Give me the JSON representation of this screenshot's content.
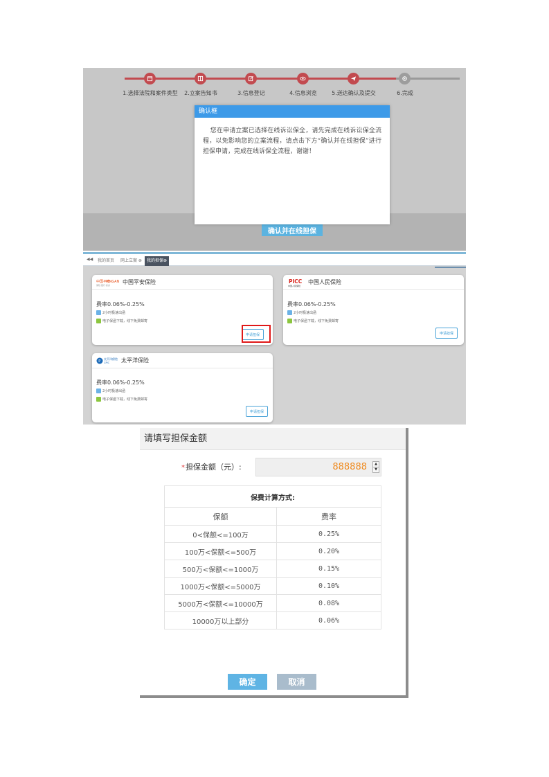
{
  "steps": [
    {
      "label": "1.选择法院和案件类型",
      "icon": "calendar-icon",
      "done": true
    },
    {
      "label": "2.立案告知书",
      "icon": "book-icon",
      "done": true
    },
    {
      "label": "3.信息登记",
      "icon": "edit-icon",
      "done": true
    },
    {
      "label": "4.信息浏览",
      "icon": "eye-icon",
      "done": true
    },
    {
      "label": "5.送达确认及提交",
      "icon": "send-icon",
      "done": true
    },
    {
      "label": "6.完成",
      "icon": "gear-icon",
      "done": false
    }
  ],
  "modal": {
    "title": "确认框",
    "body": "您在申请立案已选择在线诉讼保全，请先完成在线诉讼保全流程，以免影响您的立案流程，请点击下方“确认并在线担保”进行担保申请，完成在线诉保全流程，谢谢！"
  },
  "confirm_button": "确认并在线担保",
  "tabs": {
    "items": [
      "我的首页",
      "网上立案 ⊗",
      "我的担保⊗"
    ],
    "active_index": 2
  },
  "insurers": [
    {
      "name": "中国平安保险",
      "logo_text": "中国平安 PINGAN",
      "logo_sub": "保险·银行·投资",
      "rate": "费率0.06%-0.25%",
      "feature1": "2小时极速出函",
      "feature2": "电子保函下载，线下免费邮寄",
      "apply": "申请担保",
      "highlighted": true
    },
    {
      "name": "中国人民保险",
      "logo_text": "PICC",
      "logo_sub": "中国人民保险",
      "rate": "费率0.06%-0.25%",
      "feature1": "2小时极速出函",
      "feature2": "电子保函下载，线下免费邮寄",
      "apply": "申请担保",
      "highlighted": false
    },
    {
      "name": "太平洋保险",
      "logo_text": "太平洋保险",
      "logo_sub": "CPIC",
      "rate": "费率0.06%-0.25%",
      "feature1": "2小时极速出函",
      "feature2": "电子保函下载，线下免费邮寄",
      "apply": "申请担保",
      "highlighted": false
    }
  ],
  "form": {
    "title": "请填写担保金额",
    "amount_label": "担保金额（元）:",
    "amount_value": "888888",
    "table_caption": "保费计算方式:",
    "col_amount": "保额",
    "col_rate": "费率",
    "rows": [
      {
        "range": "0<保额<=100万",
        "rate": "0.25%"
      },
      {
        "range": "100万<保额<=500万",
        "rate": "0.20%"
      },
      {
        "range": "500万<保额<=1000万",
        "rate": "0.15%"
      },
      {
        "range": "1000万<保额<=5000万",
        "rate": "0.10%"
      },
      {
        "range": "5000万<保额<=10000万",
        "rate": "0.08%"
      },
      {
        "range": "10000万以上部分",
        "rate": "0.06%"
      }
    ],
    "ok": "确定",
    "cancel": "取消"
  },
  "colors": {
    "step_red": "#c24a4f",
    "modal_header": "#3d9ae8",
    "amount_orange": "#ef8a1e",
    "primary_blue": "#5fb4e4"
  }
}
